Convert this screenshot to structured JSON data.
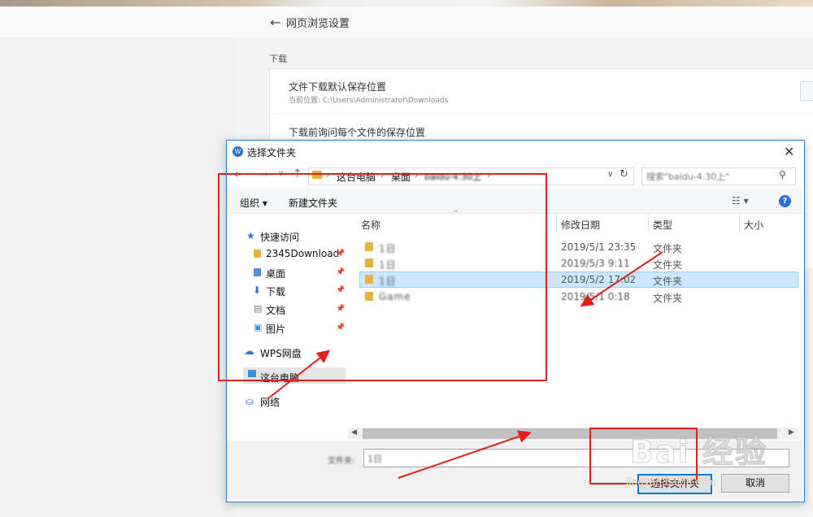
{
  "settings_page": {
    "back_icon": "arrow-left-icon",
    "title": "网页浏览设置",
    "section_label": "下载",
    "download_location_label": "文件下载默认保存位置",
    "current_location": "当前位置: C:\\Users\\Administrator\\Downloads",
    "ask_each_file_label": "下载前询问每个文件的保存位置"
  },
  "dialog": {
    "title": "选择文件夹",
    "close_icon": "close-icon",
    "address": {
      "crumbs": [
        "这台电脑",
        "桌面",
        "baidu-4.30上"
      ]
    },
    "search_placeholder": "搜索\"baidu-4.30上\"",
    "toolbar": {
      "organize": "组织 ▾",
      "new_folder": "新建文件夹"
    },
    "nav_pane": {
      "quick_access": "快速访问",
      "items": [
        "2345Download",
        "桌面",
        "下载",
        "文档",
        "图片"
      ],
      "wps": "WPS网盘",
      "this_pc": "这台电脑",
      "network": "网络"
    },
    "columns": [
      "名称",
      "修改日期",
      "类型",
      "大小"
    ],
    "files": [
      {
        "name": "1日",
        "date": "2019/5/1 23:35",
        "type": "文件夹"
      },
      {
        "name": "1日",
        "date": "2019/5/3 9:11",
        "type": "文件夹"
      },
      {
        "name": "1日",
        "date": "2019/5/2 17:02",
        "type": "文件夹",
        "selected": true
      },
      {
        "name": "Game",
        "date": "2019/5/1 0:18",
        "type": "文件夹"
      }
    ],
    "folder_label": "文件夹:",
    "folder_value": "1日",
    "select_button": "选择文件夹",
    "cancel_button": "取消"
  },
  "watermark": {
    "text": "Bai 经验",
    "sub": "jingyan.baidu.com"
  },
  "colors": {
    "accent": "#0078d7",
    "annotation_red": "#e0201d",
    "folder": "#e8b33c",
    "selection": "#cce8ff"
  }
}
